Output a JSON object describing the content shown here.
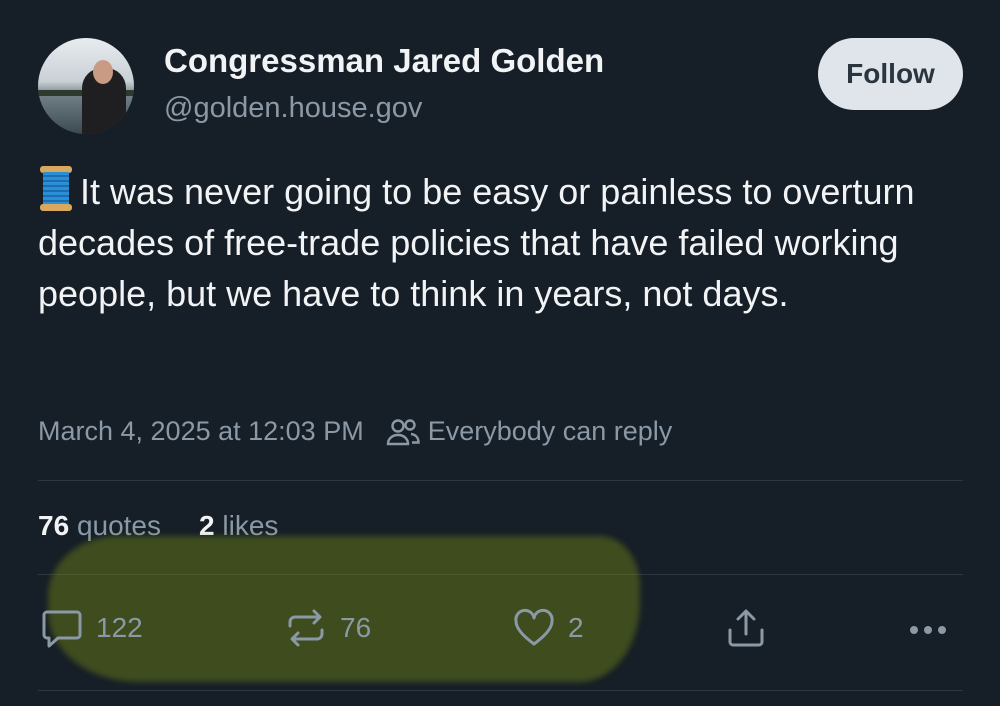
{
  "post": {
    "author_name": "Congressman Jared Golden",
    "handle": "@golden.house.gov",
    "follow_label": "Follow",
    "text": "It was never going to be easy or painless to overturn decades of free-trade policies that have failed working people, but we have to think in years, not days.",
    "timestamp": "March 4, 2025 at 12:03 PM",
    "reply_setting": "Everybody can reply"
  },
  "stats": {
    "quotes_count": "76",
    "quotes_label": "quotes",
    "likes_count": "2",
    "likes_label": "likes"
  },
  "actions": {
    "reply_count": "122",
    "repost_count": "76",
    "like_count": "2"
  },
  "icons": {
    "emoji": "spool-of-thread",
    "reply": "speech-bubble",
    "repost": "repost-arrows",
    "like": "heart",
    "share": "share-upload",
    "more": "ellipsis",
    "reply_setting": "people"
  },
  "colors": {
    "background": "#161e27",
    "text_primary": "#f1f3f5",
    "text_secondary": "#8b99a6",
    "follow_button_bg": "#dfe5ea",
    "highlight": "#6b7d12"
  }
}
